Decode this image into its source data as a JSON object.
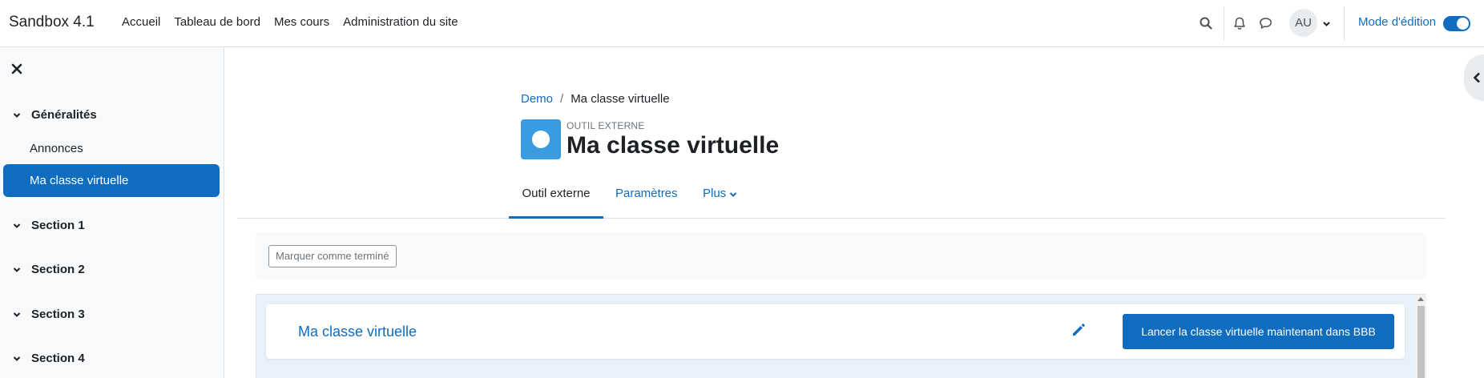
{
  "navbar": {
    "brand": "Sandbox 4.1",
    "links": [
      "Accueil",
      "Tableau de bord",
      "Mes cours",
      "Administration du site"
    ],
    "avatar_initials": "AU",
    "edit_mode_label": "Mode d'édition",
    "edit_mode_on": true,
    "icons": [
      "search-icon",
      "bell-icon",
      "chat-icon",
      "chevron-down-icon"
    ]
  },
  "sidebar": {
    "sections": [
      {
        "label": "Généralités",
        "expanded": true,
        "items": [
          "Annonces",
          "Ma classe virtuelle"
        ]
      },
      {
        "label": "Section 1"
      },
      {
        "label": "Section 2"
      },
      {
        "label": "Section 3"
      },
      {
        "label": "Section 4"
      }
    ],
    "active_item": "Ma classe virtuelle"
  },
  "header": {
    "breadcrumb": [
      "Demo",
      "Ma classe virtuelle"
    ],
    "module_type": "OUTIL EXTERNE",
    "title": "Ma classe virtuelle"
  },
  "tabs": {
    "active": "Outil externe",
    "params": "Paramètres",
    "more": "Plus"
  },
  "completion": {
    "button_label": "Marquer comme terminé"
  },
  "bbb": {
    "title": "Ma classe virtuelle",
    "launch_label": "Lancer la classe virtuelle maintenant dans BBB"
  },
  "colors": {
    "primary": "#0f6cbf",
    "module_icon": "#399be2",
    "sidebar_bg": "#f8f9fa"
  }
}
